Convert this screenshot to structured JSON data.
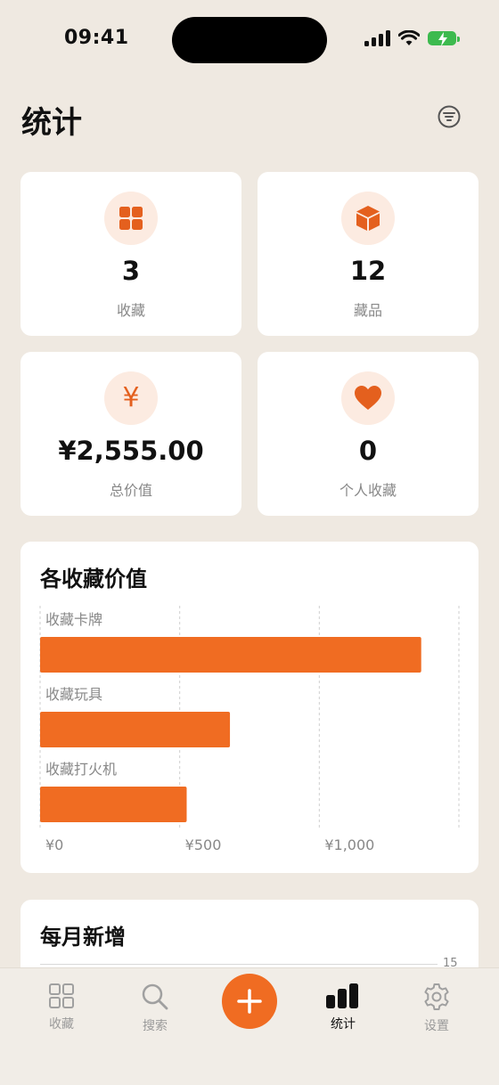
{
  "status_bar": {
    "time": "09:41"
  },
  "header": {
    "title": "统计"
  },
  "stats": [
    {
      "icon": "grid-icon",
      "value": "3",
      "label": "收藏"
    },
    {
      "icon": "cube-icon",
      "value": "12",
      "label": "藏品"
    },
    {
      "icon": "yen-icon",
      "value": "¥2,555.00",
      "label": "总价值",
      "glyph": "¥"
    },
    {
      "icon": "heart-icon",
      "value": "0",
      "label": "个人收藏"
    }
  ],
  "colors": {
    "accent": "#F06C22",
    "icon_bg": "#FCEBE1",
    "background": "#EFE9E1"
  },
  "value_chart": {
    "title": "各收藏价值"
  },
  "chart_data": {
    "type": "bar",
    "orientation": "horizontal",
    "title": "各收藏价值",
    "categories": [
      "收藏卡牌",
      "收藏玩具",
      "收藏打火机"
    ],
    "values": [
      1365,
      680,
      525
    ],
    "xlim": [
      0,
      1500
    ],
    "xticks": [
      0,
      500,
      1000
    ],
    "xtick_labels": [
      "¥0",
      "¥500",
      "¥1,000"
    ],
    "grid": true,
    "color": "#F06C22"
  },
  "monthly_chart": {
    "title": "每月新增",
    "tick_label": "15"
  },
  "tabs": [
    {
      "label": "收藏",
      "icon": "grid-icon",
      "active": false
    },
    {
      "label": "搜索",
      "icon": "search-icon",
      "active": false
    },
    {
      "label": "统计",
      "icon": "chart-icon",
      "active": true
    },
    {
      "label": "设置",
      "icon": "gear-icon",
      "active": false
    }
  ],
  "add_button": {
    "symbol": "+"
  }
}
